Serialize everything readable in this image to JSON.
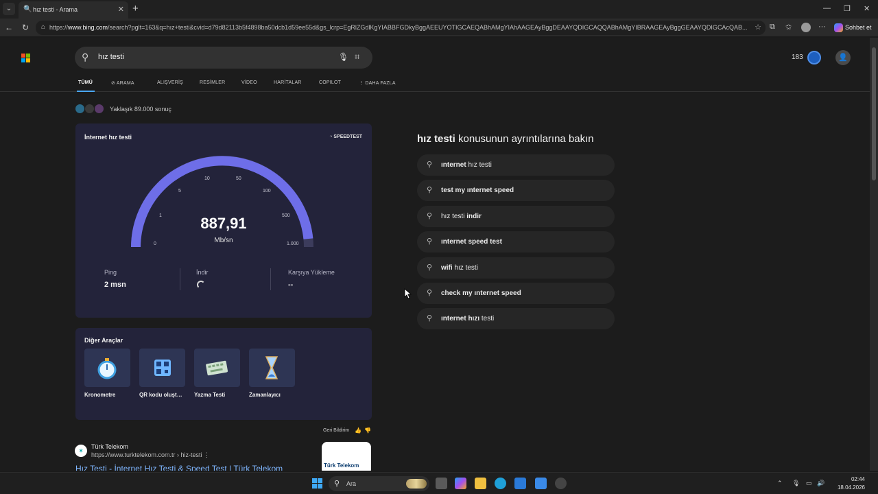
{
  "browser": {
    "tab_title": "hız testi - Arama",
    "url_prefix": "https://",
    "url_host": "www.bing.com",
    "url_rest": "/search?pglt=163&q=hız+testi&cvid=d79d82113b5f4898ba50dcb1d59ee55d&gs_lcrp=EgRlZGdlKgYIABBFGDkyBggAEEUYOTIGCAEQABhAMgYIAhAAGEAyBggDEAAYQDIGCAQQABhAMgYIBRAAGEAyBggGEAAYQDIGCAcQAB...",
    "copilot_label": "Sohbet et",
    "icons": [
      "tab-menu-icon",
      "close-icon",
      "new-tab-icon",
      "back-icon",
      "refresh-icon",
      "lock-icon",
      "star-icon",
      "extensions-icon",
      "favorites-icon",
      "more-icon"
    ]
  },
  "search": {
    "query": "hız testi",
    "rewards_points": "183"
  },
  "scopes": [
    {
      "label": "TÜMÜ"
    },
    {
      "label": "ARAMA"
    },
    {
      "label": "ALIŞVERİŞ"
    },
    {
      "label": "RESİMLER"
    },
    {
      "label": "VİDEO"
    },
    {
      "label": "HARİTALAR"
    },
    {
      "label": "COPILOT"
    },
    {
      "label": "⋮ DAHA FAZLA"
    }
  ],
  "result_count": "Yaklaşık 89.000 sonuç",
  "speedtest": {
    "title": "İnternet hız testi",
    "brand": "SPEEDTEST",
    "gauge_ticks": [
      "0",
      "1",
      "5",
      "10",
      "50",
      "100",
      "500",
      "1.000"
    ],
    "gauge_fill_fraction": 0.97,
    "value": "887,91",
    "unit": "Mb/sn",
    "ping_label": "Ping",
    "ping_value": "2 msn",
    "download_label": "İndir",
    "upload_label": "Karşıya Yükleme",
    "upload_value": "--"
  },
  "tools": {
    "title": "Diğer Araçlar",
    "items": [
      {
        "label": "Kronometre"
      },
      {
        "label": "QR kodu oluşturucu"
      },
      {
        "label": "Yazma Testi"
      },
      {
        "label": "Zamanlayıcı"
      }
    ]
  },
  "feedback_label": "Geri Bildirim",
  "result": {
    "site_name": "Türk Telekom",
    "url": "https://www.turktelekom.com.tr › hiz-testi ⋮",
    "title": "Hız Testi - İnternet Hız Testi & Speed Test | Türk Telekom",
    "thumb_text": "Türk Telekom"
  },
  "related": {
    "heading_bold": "hız testi",
    "heading_rest": " konusunun ayrıntılarına bakın",
    "items": [
      {
        "bold": "ınternet",
        "rest": " hız testi"
      },
      {
        "bold": "test my ınternet speed",
        "rest": ""
      },
      {
        "bold": "",
        "rest": "hız testi ",
        "bold2": "indir"
      },
      {
        "bold": "ınternet speed test",
        "rest": ""
      },
      {
        "bold": "wifi",
        "rest": " hız testi"
      },
      {
        "bold": "check my ınternet speed",
        "rest": ""
      },
      {
        "bold": "ınternet hızı",
        "rest": " testi"
      }
    ]
  },
  "taskbar": {
    "search_label": "Ara",
    "time": "02:44",
    "date": "18.04.2026"
  }
}
